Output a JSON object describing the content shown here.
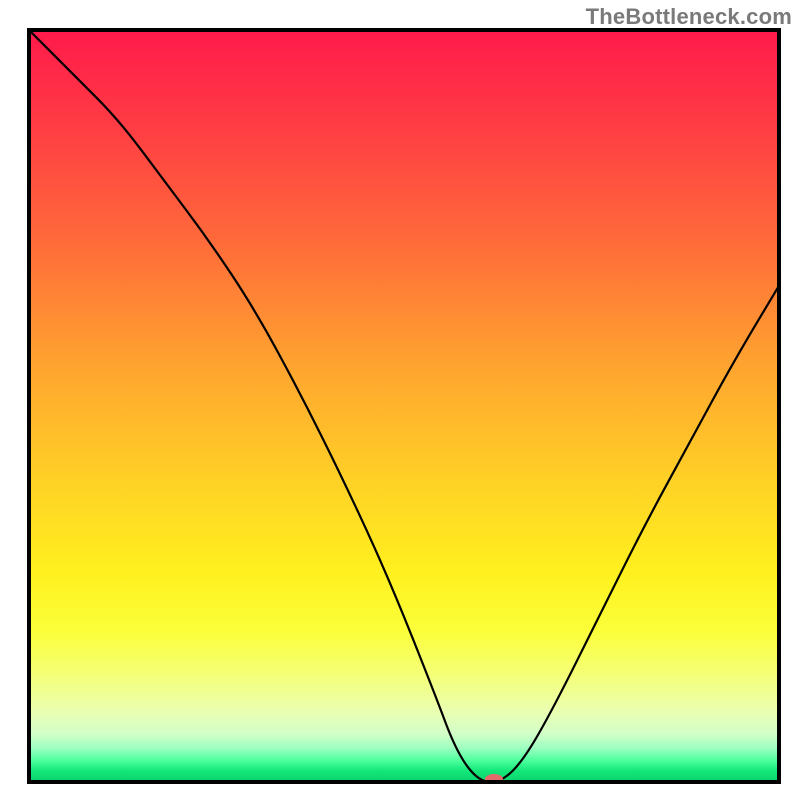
{
  "attribution": "TheBottleneck.com",
  "chart_data": {
    "type": "line",
    "title": "",
    "xlabel": "",
    "ylabel": "",
    "xlim": [
      0,
      100
    ],
    "ylim": [
      0,
      100
    ],
    "x": [
      0,
      6,
      12,
      18,
      24,
      30,
      36,
      42,
      48,
      54,
      57,
      60,
      63,
      66,
      70,
      76,
      82,
      88,
      94,
      100
    ],
    "values": [
      100,
      94,
      88,
      80,
      72,
      63,
      52,
      40,
      27,
      12,
      4,
      0,
      0,
      3,
      10,
      22,
      34,
      45,
      56,
      66
    ],
    "series_name": "bottleneck-curve",
    "marker": {
      "x": 62,
      "y": 0,
      "color": "#e46a6a",
      "rx": 9,
      "ry": 5
    },
    "background_gradient": {
      "stops": [
        {
          "offset": 0.0,
          "color": "#ff1a4b"
        },
        {
          "offset": 0.12,
          "color": "#ff3a44"
        },
        {
          "offset": 0.28,
          "color": "#ff6a3a"
        },
        {
          "offset": 0.45,
          "color": "#ffa52f"
        },
        {
          "offset": 0.6,
          "color": "#ffd126"
        },
        {
          "offset": 0.72,
          "color": "#fff01e"
        },
        {
          "offset": 0.8,
          "color": "#fbff3a"
        },
        {
          "offset": 0.86,
          "color": "#f4ff7a"
        },
        {
          "offset": 0.905,
          "color": "#eaffb0"
        },
        {
          "offset": 0.935,
          "color": "#d4ffc8"
        },
        {
          "offset": 0.955,
          "color": "#9dffc0"
        },
        {
          "offset": 0.972,
          "color": "#4aff9c"
        },
        {
          "offset": 0.985,
          "color": "#14e879"
        },
        {
          "offset": 1.0,
          "color": "#0bd06e"
        }
      ]
    },
    "axes": {
      "stroke": "#000000",
      "width": 4
    },
    "line_style": {
      "stroke": "#000000",
      "width": 2.2
    }
  }
}
